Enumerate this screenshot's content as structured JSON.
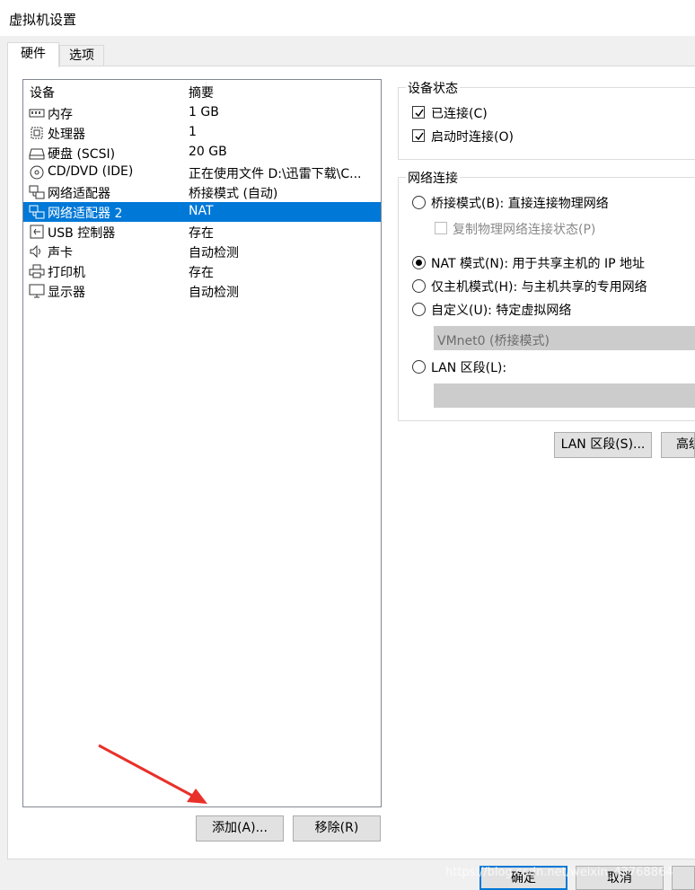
{
  "window": {
    "title": "虚拟机设置"
  },
  "tabs": [
    {
      "label": "硬件",
      "active": true
    },
    {
      "label": "选项",
      "active": false
    }
  ],
  "device_list": {
    "columns": [
      "设备",
      "摘要"
    ],
    "rows": [
      {
        "icon": "memory-icon",
        "device": "内存",
        "summary": "1 GB",
        "selected": false
      },
      {
        "icon": "processor-icon",
        "device": "处理器",
        "summary": "1",
        "selected": false
      },
      {
        "icon": "harddisk-icon",
        "device": "硬盘 (SCSI)",
        "summary": "20 GB",
        "selected": false
      },
      {
        "icon": "cdrom-icon",
        "device": "CD/DVD (IDE)",
        "summary": "正在使用文件 D:\\迅雷下载\\C...",
        "selected": false
      },
      {
        "icon": "network-adapter-icon",
        "device": "网络适配器",
        "summary": "桥接模式 (自动)",
        "selected": false
      },
      {
        "icon": "network-adapter-icon",
        "device": "网络适配器 2",
        "summary": "NAT",
        "selected": true
      },
      {
        "icon": "usb-icon",
        "device": "USB 控制器",
        "summary": "存在",
        "selected": false
      },
      {
        "icon": "speaker-icon",
        "device": "声卡",
        "summary": "自动检测",
        "selected": false
      },
      {
        "icon": "printer-icon",
        "device": "打印机",
        "summary": "存在",
        "selected": false
      },
      {
        "icon": "monitor-icon",
        "device": "显示器",
        "summary": "自动检测",
        "selected": false
      }
    ]
  },
  "list_buttons": {
    "add": "添加(A)...",
    "remove": "移除(R)"
  },
  "device_status": {
    "label": "设备状态",
    "connected": {
      "label": "已连接(C)",
      "checked": true
    },
    "connect_at_power_on": {
      "label": "启动时连接(O)",
      "checked": true
    }
  },
  "network_connection": {
    "label": "网络连接",
    "bridged": {
      "label": "桥接模式(B): 直接连接物理网络",
      "selected": false
    },
    "replicate": {
      "label": "复制物理网络连接状态(P)",
      "checked": false,
      "enabled": false
    },
    "nat": {
      "label": "NAT 模式(N): 用于共享主机的 IP 地址",
      "selected": true
    },
    "host_only": {
      "label": "仅主机模式(H): 与主机共享的专用网络",
      "selected": false
    },
    "custom": {
      "label": "自定义(U): 特定虚拟网络",
      "selected": false
    },
    "custom_select_value": "VMnet0 (桥接模式)",
    "lan_segment": {
      "label": "LAN 区段(L):",
      "selected": false
    },
    "lan_select_value": ""
  },
  "right_buttons": {
    "lan_segments": "LAN 区段(S)...",
    "advanced": "高级"
  },
  "dialog_buttons": {
    "ok": "确定",
    "cancel": "取消"
  },
  "watermark": "https://blog.csdn.net/weixin_43768864"
}
